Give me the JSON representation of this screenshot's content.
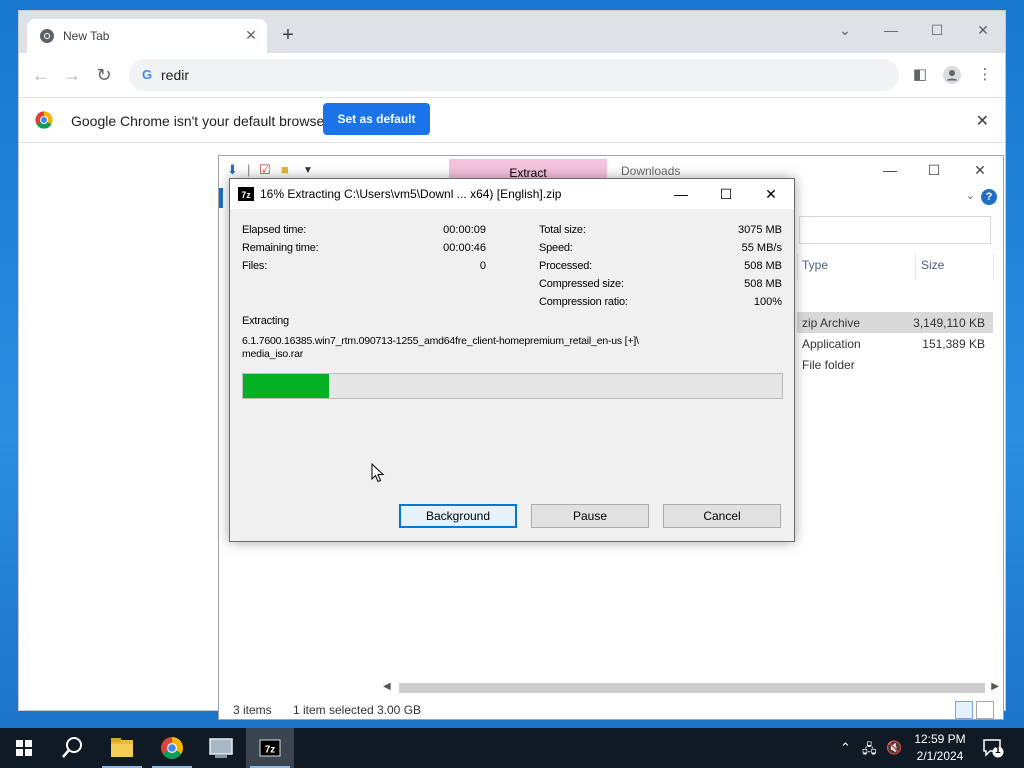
{
  "chrome": {
    "tab_title": "New Tab",
    "new_tab_symbol": "+",
    "address": "redir",
    "infobar_message": "Google Chrome isn't your default browser",
    "set_default_label": "Set as default"
  },
  "explorer": {
    "extract_tab": "Extract",
    "title": "Downloads",
    "columns": {
      "type": "Type",
      "size": "Size"
    },
    "rows": [
      {
        "type": "zip Archive",
        "size": "3,149,110 KB"
      },
      {
        "type": "Application",
        "size": "151,389 KB"
      },
      {
        "type": "File folder",
        "size": ""
      }
    ],
    "status": {
      "items": "3 items",
      "selected": "1 item selected",
      "selected_size": "3.00 GB"
    }
  },
  "dialog": {
    "app_badge": "7z",
    "title": "16% Extracting C:\\Users\\vm5\\Downl ... x64) [English].zip",
    "elapsed_label": "Elapsed time:",
    "elapsed_value": "00:00:09",
    "remaining_label": "Remaining time:",
    "remaining_value": "00:00:46",
    "files_label": "Files:",
    "files_value": "0",
    "total_size_label": "Total size:",
    "total_size_value": "3075 MB",
    "speed_label": "Speed:",
    "speed_value": "55 MB/s",
    "processed_label": "Processed:",
    "processed_value": "508 MB",
    "compressed_label": "Compressed size:",
    "compressed_value": "508 MB",
    "ratio_label": "Compression ratio:",
    "ratio_value": "100%",
    "extracting_label": "Extracting",
    "current_file_line1": "6.1.7600.16385.win7_rtm.090713-1255_amd64fre_client-homepremium_retail_en-us [+]\\",
    "current_file_line2": "media_iso.rar",
    "progress_percent": 16,
    "buttons": {
      "background": "Background",
      "pause": "Pause",
      "cancel": "Cancel"
    }
  },
  "taskbar": {
    "time": "12:59 PM",
    "date": "2/1/2024",
    "notification_count": "1"
  },
  "colors": {
    "progress_fill": "#06b025",
    "chrome_primary": "#1a73e8",
    "taskbar": "#101a24"
  }
}
